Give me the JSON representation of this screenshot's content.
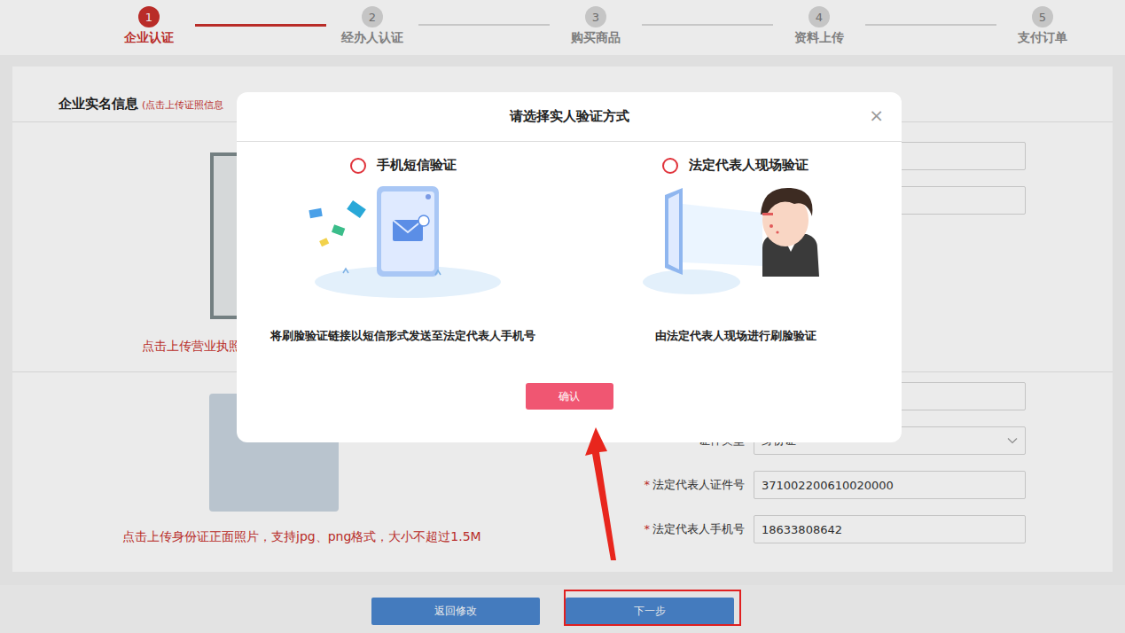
{
  "steps": [
    {
      "number": "1",
      "label": "企业认证",
      "selected": true
    },
    {
      "number": "2",
      "label": "经办人认证",
      "selected": false
    },
    {
      "number": "3",
      "label": "购买商品",
      "selected": false
    },
    {
      "number": "4",
      "label": "资料上传",
      "selected": false
    },
    {
      "number": "5",
      "label": "支付订单",
      "selected": false
    }
  ],
  "form": {
    "title": "企业实名信息",
    "hint": "(点击上传证照信息",
    "required_mark": "*",
    "license_upload_hint": "点击上传营业执照",
    "id_upload_hint": "点击上传身份证正面照片，支持jpg、png格式，大小不超过1.5M",
    "upper_fields": [
      {
        "label": "",
        "value": "",
        "kind": "input",
        "required": false
      },
      {
        "label": "",
        "value": "",
        "kind": "input",
        "required": false
      }
    ],
    "lower_fields": [
      {
        "label": "",
        "value": "",
        "kind": "input",
        "required": false
      },
      {
        "label": "证件类型",
        "value": "身份证",
        "kind": "select",
        "required": false
      },
      {
        "label": "法定代表人证件号",
        "value": "371002200610020000",
        "kind": "input",
        "required": true
      },
      {
        "label": "法定代表人手机号",
        "value": "18633808642",
        "kind": "input",
        "required": true
      }
    ]
  },
  "buttons": [
    {
      "label": "返回修改",
      "highlighted": false
    },
    {
      "label": "下一步",
      "highlighted": true
    }
  ],
  "modal": {
    "title": "请选择实人验证方式",
    "close": "×",
    "options": [
      {
        "label": "手机短信验证",
        "description": "将刷脸验证链接以短信形式发送至法定代表人手机号",
        "selected": false,
        "kind": "sms"
      },
      {
        "label": "法定代表人现场验证",
        "description": "由法定代表人现场进行刷脸验证",
        "selected": false,
        "kind": "face"
      }
    ],
    "confirm": "确认"
  }
}
